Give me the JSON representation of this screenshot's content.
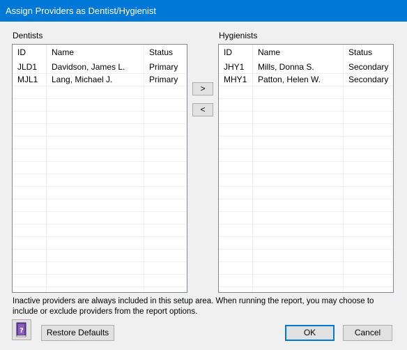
{
  "window": {
    "title": "Assign Providers as Dentist/Hygienist"
  },
  "dentists": {
    "label": "Dentists",
    "columns": [
      "ID",
      "Name",
      "Status"
    ],
    "rows": [
      {
        "id": "JLD1",
        "name": "Davidson, James L.",
        "status": "Primary"
      },
      {
        "id": "MJL1",
        "name": "Lang, Michael J.",
        "status": "Primary"
      }
    ]
  },
  "hygienists": {
    "label": "Hygienists",
    "columns": [
      "ID",
      "Name",
      "Status"
    ],
    "rows": [
      {
        "id": "JHY1",
        "name": "Mills, Donna S.",
        "status": "Secondary"
      },
      {
        "id": "MHY1",
        "name": "Patton, Helen W.",
        "status": "Secondary"
      }
    ]
  },
  "transfer": {
    "move_right_label": ">",
    "move_left_label": "<"
  },
  "info_text": "Inactive providers are always included in this setup area. When running the report, you may choose to include or exclude providers from the report options.",
  "buttons": {
    "help_icon": "help-book-icon",
    "restore_label": "Restore Defaults",
    "ok_label": "OK",
    "cancel_label": "Cancel"
  }
}
